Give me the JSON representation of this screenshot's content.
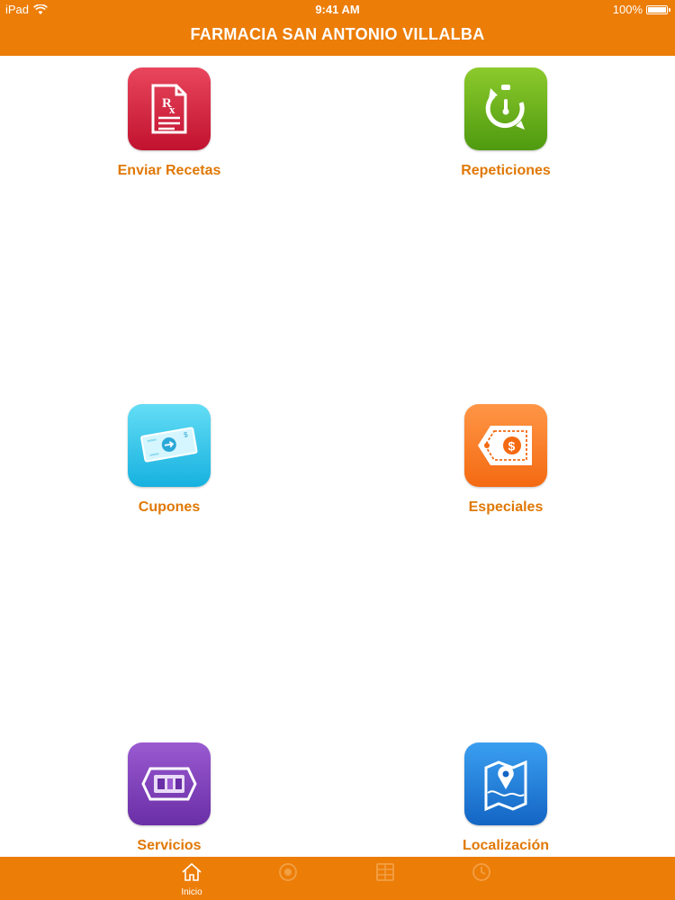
{
  "status_bar": {
    "device": "iPad",
    "time": "9:41 AM",
    "battery": "100%"
  },
  "header": {
    "title": "FARMACIA SAN ANTONIO VILLALBA"
  },
  "tiles": [
    {
      "label": "Enviar Recetas",
      "icon": "prescription-icon",
      "color": "#d42a43"
    },
    {
      "label": "Repeticiones",
      "icon": "refill-timer-icon",
      "color": "#6db31d"
    },
    {
      "label": "Cupones",
      "icon": "coupon-ticket-icon",
      "color": "#2fc6ea"
    },
    {
      "label": "Especiales",
      "icon": "price-tag-icon",
      "color": "#fb7d28"
    },
    {
      "label": "Servicios",
      "icon": "medical-kit-icon",
      "color": "#7f43bb"
    },
    {
      "label": "Localización",
      "icon": "map-pin-icon",
      "color": "#2582db"
    }
  ],
  "tabbar": {
    "tabs": [
      {
        "label": "Inicio",
        "icon": "home-icon",
        "active": true
      },
      {
        "label": "",
        "icon": "tab-icon-2",
        "active": false
      },
      {
        "label": "",
        "icon": "tab-icon-3",
        "active": false
      },
      {
        "label": "",
        "icon": "tab-icon-4",
        "active": false
      }
    ]
  },
  "colors": {
    "brand": "#ec7d07",
    "label": "#e07806",
    "background": "#ffffff"
  }
}
